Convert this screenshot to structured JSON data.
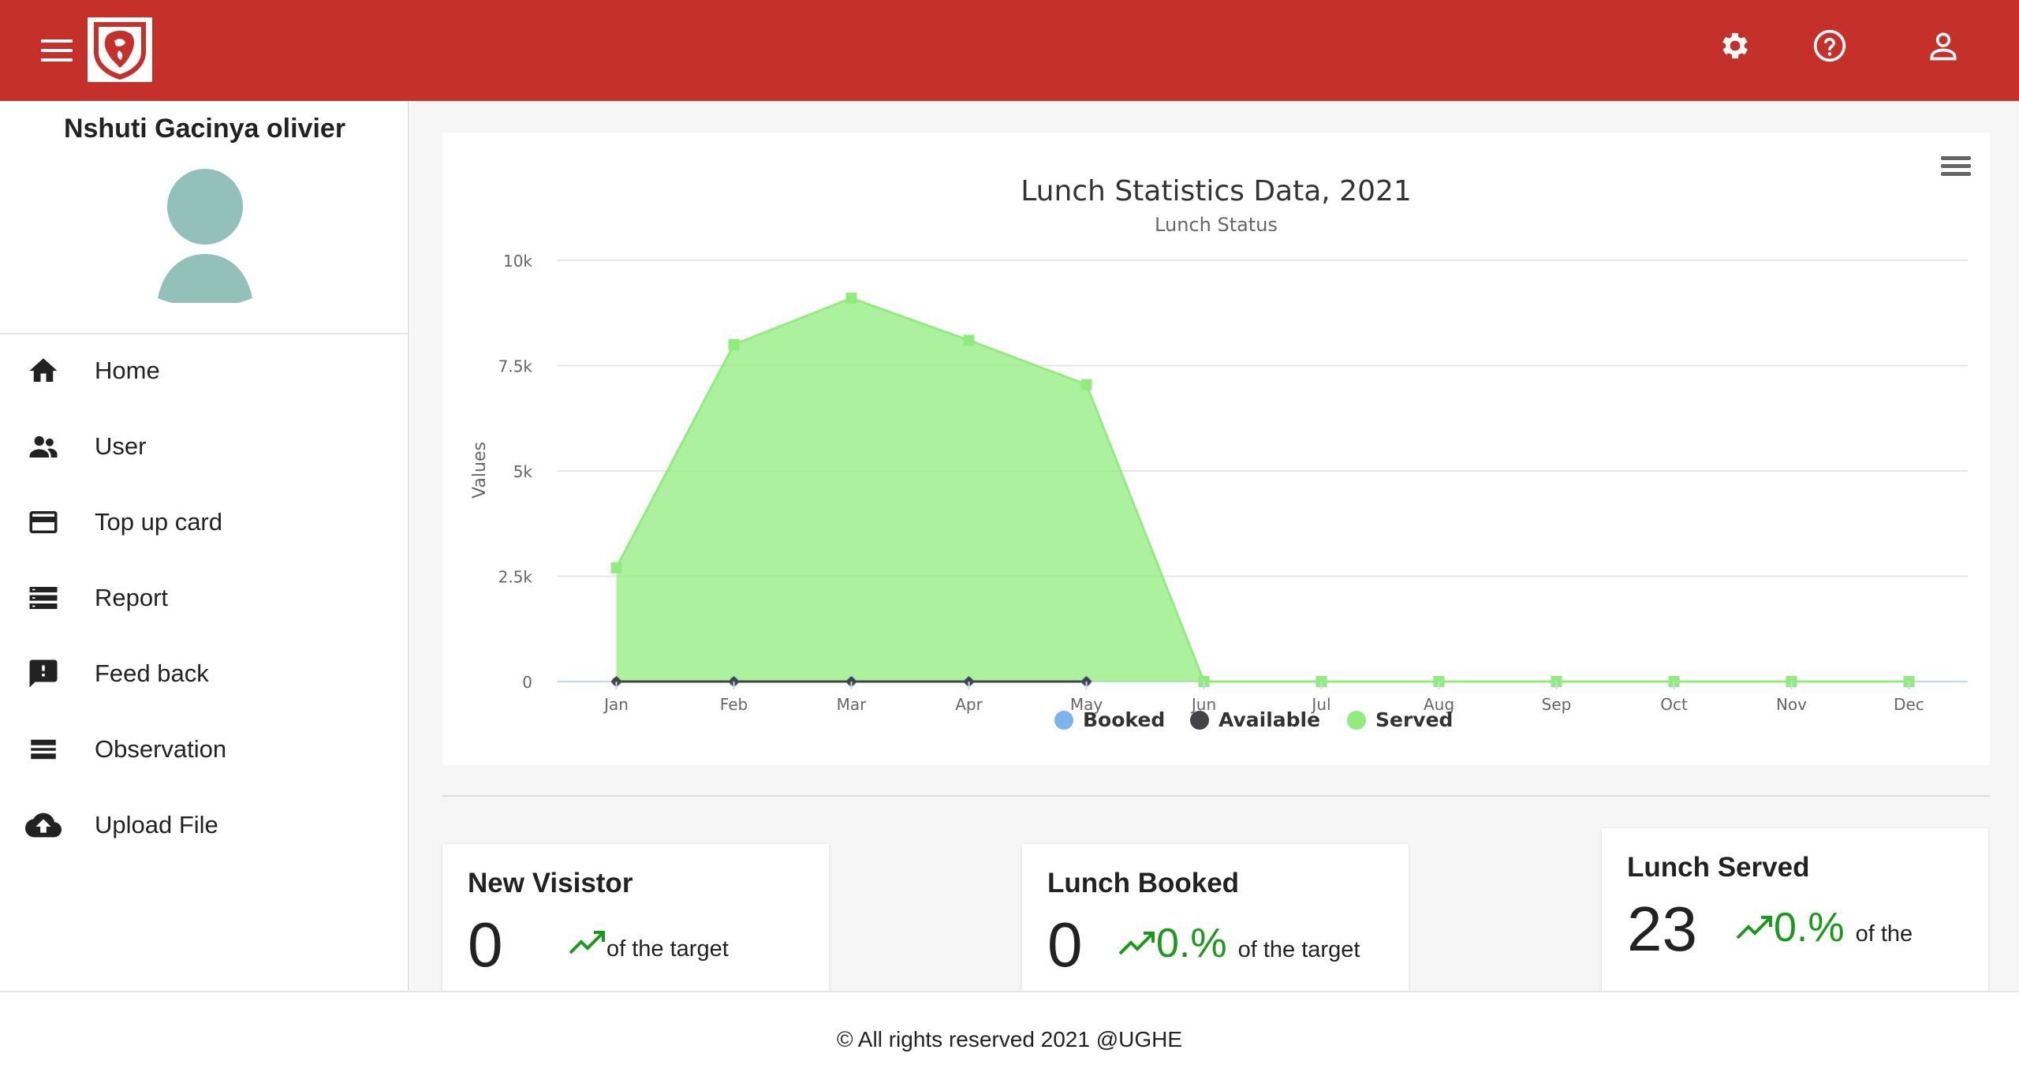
{
  "header": {
    "menu_icon": "hamburger-menu-icon",
    "logo_icon": "lion-shield-logo",
    "settings_icon": "gear-icon",
    "help_icon": "help-circle-icon",
    "account_icon": "person-icon",
    "brand_color": "#c5302b"
  },
  "sidebar": {
    "user_name": "Nshuti Gacinya olivier",
    "avatar_icon": "avatar-placeholder-icon",
    "items": [
      {
        "label": "Home",
        "icon": "home-icon"
      },
      {
        "label": "User",
        "icon": "people-icon"
      },
      {
        "label": "Top up card",
        "icon": "credit-card-icon"
      },
      {
        "label": "Report",
        "icon": "list-icon"
      },
      {
        "label": "Feed back",
        "icon": "feedback-icon"
      },
      {
        "label": "Observation",
        "icon": "table-rows-icon"
      },
      {
        "label": "Upload File",
        "icon": "cloud-upload-icon"
      }
    ]
  },
  "chart_data": {
    "type": "area",
    "title": "Lunch Statistics Data, 2021",
    "subtitle": "Lunch Status",
    "xlabel": "",
    "ylabel": "Values",
    "categories": [
      "Jan",
      "Feb",
      "Mar",
      "Apr",
      "May",
      "Jun",
      "Jul",
      "Aug",
      "Sep",
      "Oct",
      "Nov",
      "Dec"
    ],
    "ylim": [
      0,
      10000
    ],
    "y_ticks": [
      "0",
      "2.5k",
      "5k",
      "7.5k",
      "10k"
    ],
    "y_tick_values": [
      0,
      2500,
      5000,
      7500,
      10000
    ],
    "grid": true,
    "legend_position": "bottom",
    "series": [
      {
        "name": "Booked",
        "color": "#7cb5ec",
        "values": [
          0,
          0,
          0,
          0,
          0,
          null,
          null,
          null,
          null,
          null,
          null,
          null
        ]
      },
      {
        "name": "Available",
        "color": "#434348",
        "values": [
          0,
          0,
          0,
          0,
          0,
          null,
          null,
          null,
          null,
          null,
          null,
          null
        ]
      },
      {
        "name": "Served",
        "color": "#90ed7d",
        "values": [
          2700,
          8000,
          9100,
          8100,
          7050,
          0,
          0,
          0,
          0,
          0,
          0,
          0
        ]
      }
    ],
    "menu_icon": "chart-context-menu-icon"
  },
  "stats": [
    {
      "title": "New Visistor",
      "value": "0",
      "percent": "",
      "note": "of the target",
      "trend_icon": "trending-up-icon"
    },
    {
      "title": "Lunch Booked",
      "value": "0",
      "percent": "0.%",
      "note": "of the target",
      "trend_icon": "trending-up-icon"
    },
    {
      "title": "Lunch Served",
      "value": "23",
      "percent": "0.%",
      "note": "of the",
      "trend_icon": "trending-up-icon"
    }
  ],
  "trend_color": "#1a9a1a",
  "footer": {
    "text": "© All rights reserved 2021 @UGHE"
  }
}
